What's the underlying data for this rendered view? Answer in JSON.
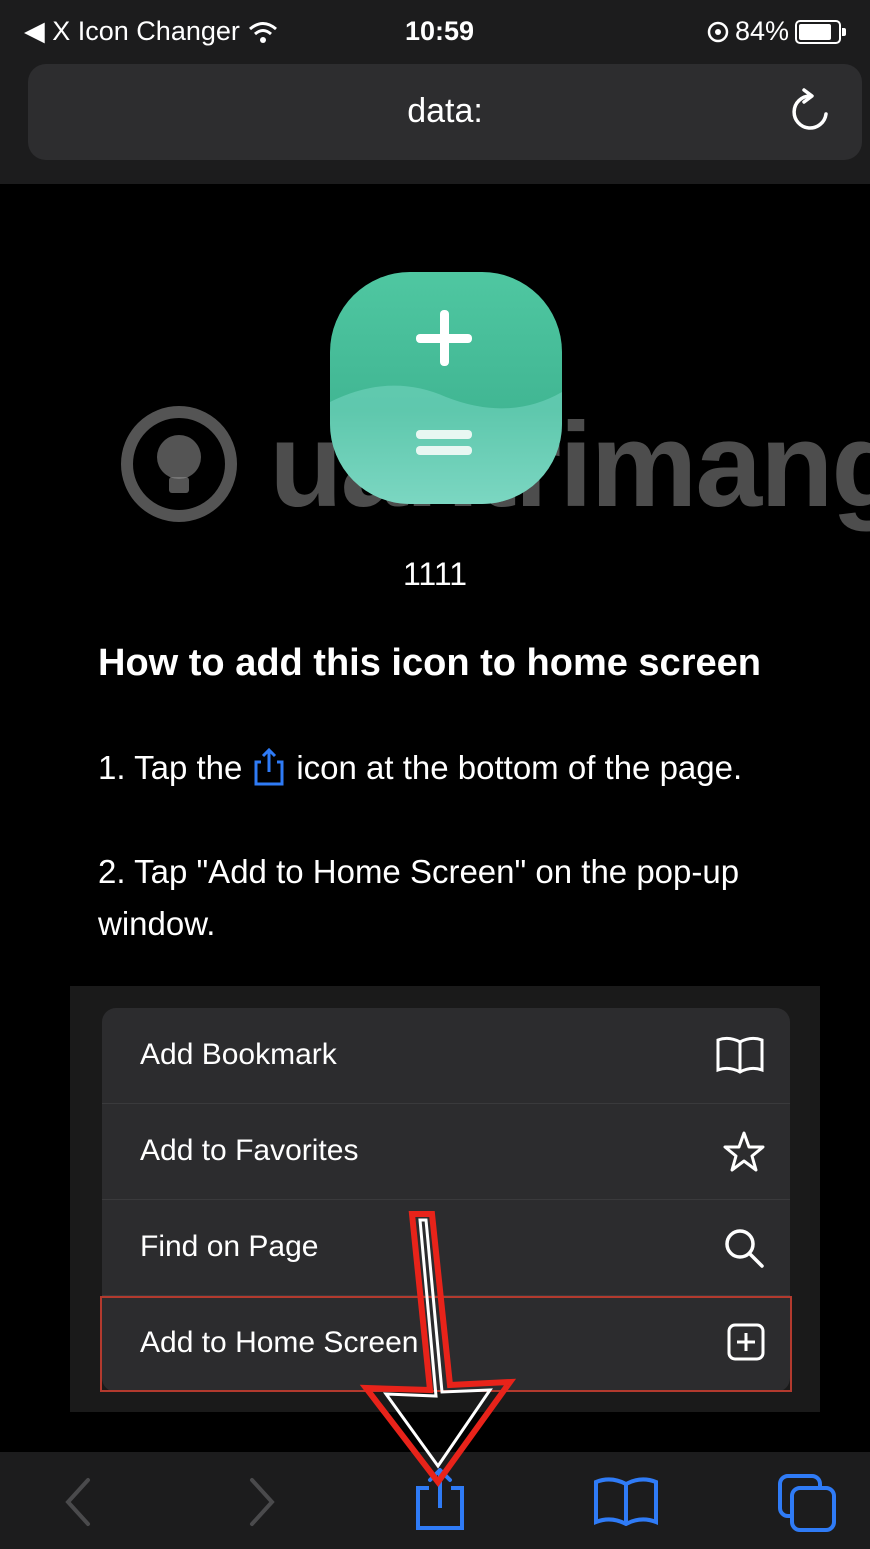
{
  "status_bar": {
    "back_app": "◀ X Icon Changer",
    "time": "10:59",
    "battery_percent": "84%",
    "battery_level": 0.84
  },
  "address_bar": {
    "url": "data:"
  },
  "page": {
    "icon_caption": "1111",
    "heading": "How to add this icon to home screen",
    "step1_before": "1. Tap the",
    "step1_after": "icon at the bottom of the page.",
    "step2": "2. Tap \"Add to Home Screen\" on the pop-up window."
  },
  "watermark": "Quantrimang",
  "share_menu": {
    "items": [
      {
        "label": "Add Bookmark",
        "icon": "book-icon"
      },
      {
        "label": "Add to Favorites",
        "icon": "star-icon"
      },
      {
        "label": "Find on Page",
        "icon": "search-icon"
      },
      {
        "label": "Add to Home Screen",
        "icon": "plus-square-icon"
      }
    ]
  },
  "toolbar": {
    "buttons": [
      "back-icon",
      "forward-icon",
      "share-icon",
      "bookmarks-icon",
      "tabs-icon"
    ]
  },
  "colors": {
    "accent_blue": "#2f7bf6",
    "highlight_red": "#b33a2e",
    "icon_green": "#4fc7a1"
  }
}
